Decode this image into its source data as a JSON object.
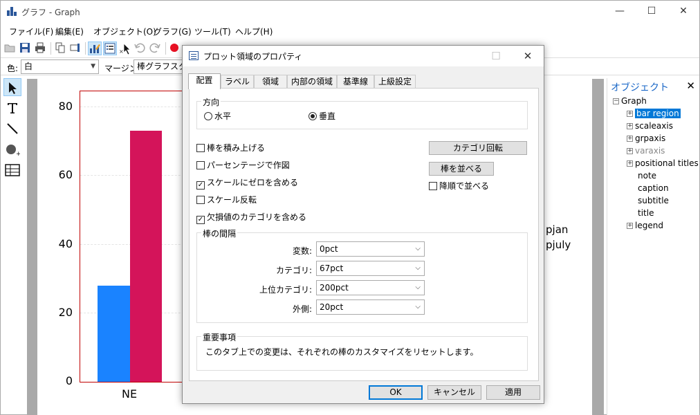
{
  "window": {
    "title": "グラフ - Graph",
    "minimize": "—",
    "maximize": "☐",
    "close": "✕"
  },
  "menu": [
    "ファイル(F)",
    "編集(E)",
    "オブジェクト(O)",
    "グラフ(G)",
    "ツール(T)",
    "ヘルプ(H)"
  ],
  "propbar": {
    "color_label": "色:",
    "color_value": "白",
    "margin_label": "マージン:",
    "margin_value": "棒グラフスタイル"
  },
  "graph": {
    "yticks": [
      "80",
      "60",
      "40",
      "20",
      "0"
    ],
    "category": "NE",
    "legend": [
      "pjan",
      "pjuly"
    ],
    "colors": {
      "series1": "#1a83ff",
      "series2": "#d4145a",
      "region_border": "#c00000"
    }
  },
  "chart_data": {
    "type": "bar",
    "categories": [
      "NE"
    ],
    "series": [
      {
        "name": "pjan",
        "values": [
          28
        ]
      },
      {
        "name": "pjuly",
        "values": [
          73
        ]
      }
    ],
    "ylim": [
      0,
      84
    ],
    "yticks": [
      0,
      20,
      40,
      60,
      80
    ]
  },
  "objects": {
    "title": "オブジェクト",
    "close": "✕",
    "root": "Graph",
    "items": [
      "bar region",
      "scaleaxis",
      "grpaxis",
      "varaxis",
      "positional titles",
      "note",
      "caption",
      "subtitle",
      "title",
      "legend"
    ]
  },
  "dialog": {
    "title": "プロット領域のプロパティ",
    "minimize": "—",
    "maximize": "☐",
    "close": "✕",
    "tabs": [
      "配置",
      "ラベル",
      "領域",
      "内部の領域",
      "基準線",
      "上級設定"
    ],
    "direction": {
      "title": "方向",
      "horizontal": "水平",
      "vertical": "垂直"
    },
    "checks": {
      "stack": "棒を積み上げる",
      "percent": "パーセンテージで作図",
      "include_zero": "スケールにゼロを含める",
      "reverse": "スケール反転",
      "missing": "欠損値のカテゴリを含める",
      "descending": "降順で並べる"
    },
    "buttons": {
      "rotate": "カテゴリ回転",
      "sort": "棒を並べる",
      "ok": "OK",
      "cancel": "キャンセル",
      "apply": "適用"
    },
    "gap": {
      "title": "棒の間隔",
      "variable_label": "変数:",
      "variable_value": "0pct",
      "category_label": "カテゴリ:",
      "category_value": "67pct",
      "upper_label": "上位カテゴリ:",
      "upper_value": "200pct",
      "outer_label": "外側:",
      "outer_value": "20pct"
    },
    "important": {
      "title": "重要事項",
      "text": "このタブ上での変更は、それぞれの棒のカスタマイズをリセットします。"
    },
    "check_mark": "✓",
    "arrow": "⌵"
  }
}
